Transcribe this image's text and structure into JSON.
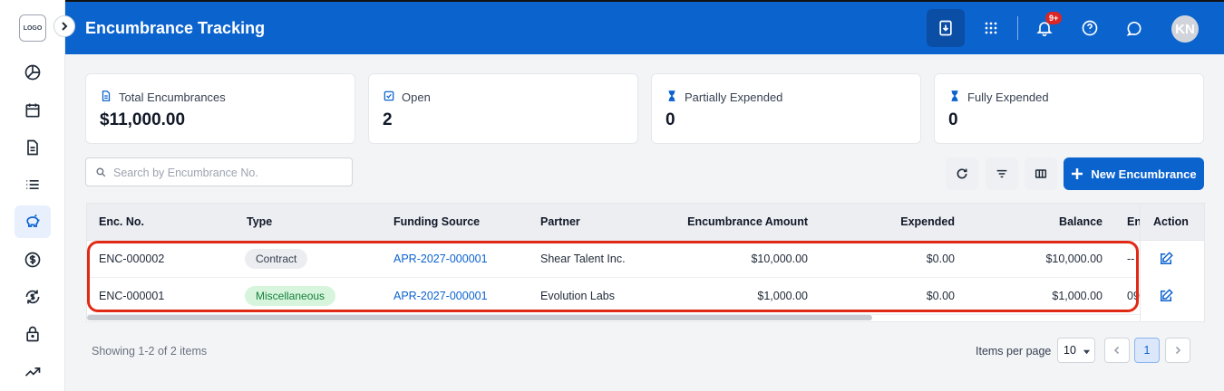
{
  "app": {
    "logo_text": "LOGO",
    "title": "Encumbrance Tracking",
    "notification_count": "9+",
    "avatar_initials": "KN",
    "accent_color": "#0b63ce"
  },
  "sidebar": {
    "items": [
      {
        "icon": "pie-chart-icon"
      },
      {
        "icon": "calendar-icon"
      },
      {
        "icon": "document-icon"
      },
      {
        "icon": "list-icon"
      },
      {
        "icon": "piggy-bank-icon",
        "active": true
      },
      {
        "icon": "dollar-circle-icon"
      },
      {
        "icon": "dollar-refresh-icon"
      },
      {
        "icon": "lock-icon"
      },
      {
        "icon": "trend-icon"
      }
    ]
  },
  "stats": [
    {
      "label": "Total Encumbrances",
      "value": "$11,000.00",
      "icon": "document-icon"
    },
    {
      "label": "Open",
      "value": "2",
      "icon": "checkbox-icon"
    },
    {
      "label": "Partially Expended",
      "value": "0",
      "icon": "hourglass-icon"
    },
    {
      "label": "Fully Expended",
      "value": "0",
      "icon": "hourglass-icon"
    }
  ],
  "toolbar": {
    "search_placeholder": "Search by Encumbrance No.",
    "new_button_label": "New Encumbrance"
  },
  "table": {
    "columns": [
      "Enc. No.",
      "Type",
      "Funding Source",
      "Partner",
      "Encumbrance Amount",
      "Expended",
      "Balance",
      "En",
      "Action"
    ],
    "rows": [
      {
        "enc_no": "ENC-000002",
        "type": "Contract",
        "type_style": "gray",
        "funding_source": "APR-2027-000001",
        "partner": "Shear Talent Inc.",
        "amount": "$10,000.00",
        "expended": "$0.00",
        "balance": "$10,000.00",
        "extra": "--"
      },
      {
        "enc_no": "ENC-000001",
        "type": "Miscellaneous",
        "type_style": "green",
        "funding_source": "APR-2027-000001",
        "partner": "Evolution Labs",
        "amount": "$1,000.00",
        "expended": "$0.00",
        "balance": "$1,000.00",
        "extra": "09"
      }
    ]
  },
  "footer": {
    "showing": "Showing 1-2 of 2 items",
    "items_per_page_label": "Items per page",
    "items_per_page": "10",
    "current_page": "1"
  }
}
